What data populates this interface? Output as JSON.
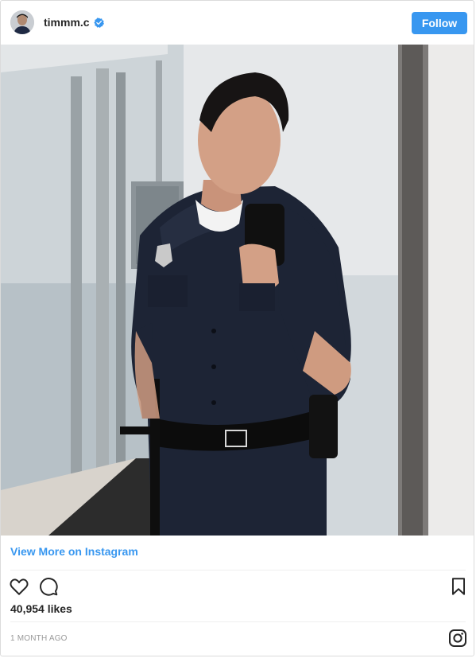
{
  "post": {
    "username": "timmm.c",
    "verified": true,
    "follow_label": "Follow",
    "view_more_label": "View More on Instagram",
    "likes": "40,954 likes",
    "timestamp": "1 MONTH AGO"
  },
  "icons": {
    "header": [
      "avatar",
      "verified-badge-icon"
    ],
    "actions": [
      "heart-icon",
      "comment-icon",
      "bookmark-icon"
    ],
    "footer": [
      "instagram-logo-icon"
    ]
  },
  "colors": {
    "accent": "#3897f0",
    "text": "#262626",
    "muted": "#999999",
    "border": "#dbdbdb"
  }
}
